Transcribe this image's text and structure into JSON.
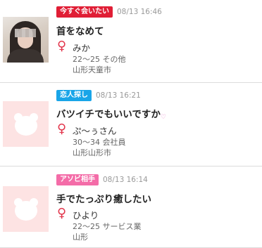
{
  "colors": {
    "female_icon": "#e2364c",
    "placeholder_bg": "#fde3e3",
    "placeholder_icon": "#ffffff"
  },
  "posts": [
    {
      "tag": "今すぐ会いたい",
      "tag_color": "#e01e35",
      "timestamp": "08/13 16:46",
      "title": "首をなめて",
      "heart": "",
      "name": "みか",
      "age_job": "22～25 その他",
      "location": "山形天童市",
      "thumbnail": "user-photo"
    },
    {
      "tag": "恋人探し",
      "tag_color": "#19a5e8",
      "timestamp": "08/13 16:21",
      "title": "バツイチでもいいですか",
      "heart": "♡",
      "name": "ぷ～ぅさん",
      "age_job": "30～34 会社員",
      "location": "山形山形市",
      "thumbnail": "no-photo"
    },
    {
      "tag": "アソビ相手",
      "tag_color": "#f46ca8",
      "timestamp": "08/13 16:14",
      "title": "手でたっぷり癒したい",
      "heart": "",
      "name": "ひより",
      "age_job": "22～25 サービス業",
      "location": "山形",
      "thumbnail": "no-photo"
    }
  ]
}
